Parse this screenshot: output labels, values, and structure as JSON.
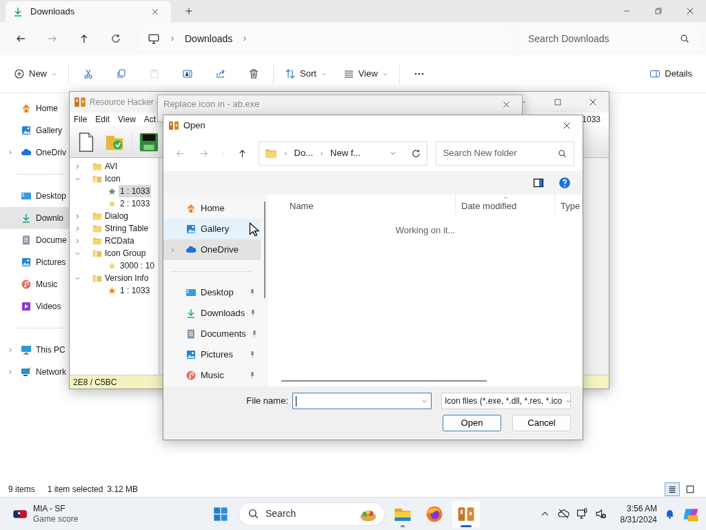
{
  "explorer": {
    "tab": {
      "title": "Downloads"
    },
    "nav_buttons": [
      {
        "kind": "back",
        "disabled": false
      },
      {
        "kind": "forward",
        "disabled": true
      },
      {
        "kind": "up",
        "disabled": false
      },
      {
        "kind": "refresh",
        "disabled": false
      }
    ],
    "address": {
      "path": [
        "Downloads"
      ]
    },
    "search": {
      "placeholder": "Search Downloads"
    },
    "commands": [
      {
        "kind": "new",
        "label": "New",
        "disabled": false
      },
      {
        "kind": "cut",
        "disabled": false
      },
      {
        "kind": "copy",
        "disabled": false
      },
      {
        "kind": "paste",
        "disabled": true
      },
      {
        "kind": "rename",
        "disabled": false
      },
      {
        "kind": "share",
        "disabled": false
      },
      {
        "kind": "delete",
        "disabled": false
      },
      {
        "kind": "sort",
        "label": "Sort",
        "disabled": false
      },
      {
        "kind": "view",
        "label": "View",
        "disabled": false
      },
      {
        "kind": "more",
        "disabled": false
      }
    ],
    "details_button": "Details",
    "sidebar": {
      "groups": [
        [
          {
            "kind": "home",
            "label": "Home",
            "selected": false,
            "expandable": false
          },
          {
            "kind": "gallery",
            "label": "Gallery",
            "selected": false,
            "expandable": false
          },
          {
            "kind": "cloud",
            "label": "OneDriv",
            "selected": false,
            "expandable": true
          }
        ],
        [
          {
            "kind": "desktop",
            "label": "Desktop",
            "selected": false,
            "expandable": false
          },
          {
            "kind": "download",
            "label": "Downlo",
            "selected": true,
            "expandable": false
          },
          {
            "kind": "document",
            "label": "Docume",
            "selected": false,
            "expandable": false
          },
          {
            "kind": "pictures",
            "label": "Pictures",
            "selected": false,
            "expandable": false
          },
          {
            "kind": "music",
            "label": "Music",
            "selected": false,
            "expandable": false
          },
          {
            "kind": "videos",
            "label": "Videos",
            "selected": false,
            "expandable": false
          }
        ],
        [
          {
            "kind": "pc",
            "label": "This PC",
            "selected": false,
            "expandable": true
          },
          {
            "kind": "network",
            "label": "Network",
            "selected": false,
            "expandable": true
          }
        ]
      ]
    },
    "status": {
      "count": "9 items",
      "selection": "1 item selected",
      "size": "3.12 MB"
    },
    "view_modes": [
      {
        "kind": "details",
        "selected": true
      },
      {
        "kind": "tiles",
        "selected": false
      }
    ]
  },
  "resource_hacker": {
    "title": "Resource Hacker -",
    "menu": [
      "File",
      "Edit",
      "View",
      "Act"
    ],
    "toolbar": [
      {
        "kind": "new"
      },
      {
        "kind": "open"
      },
      {
        "kind": "save"
      }
    ],
    "side_value": "1033",
    "tree": [
      {
        "label": "AVI",
        "expanded": false
      },
      {
        "label": "Icon",
        "expanded": true,
        "children": [
          {
            "label": "1 : 1033",
            "selected": true,
            "color": "#6f8f5a"
          },
          {
            "label": "2 : 1033",
            "selected": false,
            "color": "#f2d36b"
          }
        ]
      },
      {
        "label": "Dialog",
        "expanded": false
      },
      {
        "label": "String Table",
        "expanded": false
      },
      {
        "label": "RCData",
        "expanded": false
      },
      {
        "label": "Icon Group",
        "expanded": true,
        "children": [
          {
            "label": "3000 : 10",
            "selected": false,
            "color": "#f2d36b"
          }
        ]
      },
      {
        "label": "Version Info",
        "expanded": true,
        "children": [
          {
            "label": "1 : 1033",
            "selected": false,
            "color": "#f08a24"
          }
        ]
      }
    ],
    "status": "2E8 / C5BC"
  },
  "replace_dialog": {
    "title": "Replace icon in - ab.exe"
  },
  "open_dialog": {
    "title": "Open",
    "nav_buttons": [
      {
        "kind": "back",
        "disabled": true
      },
      {
        "kind": "forward",
        "disabled": true
      },
      {
        "kind": "recent",
        "disabled": true
      },
      {
        "kind": "up",
        "disabled": false
      }
    ],
    "breadcrumb": [
      "Do...",
      "New f..."
    ],
    "search": {
      "placeholder": "Search New folder"
    },
    "nav_pane": {
      "groups": [
        [
          {
            "kind": "home",
            "label": "Home",
            "selected": false,
            "hovered": false,
            "expandable": false,
            "pinned": false
          },
          {
            "kind": "gallery",
            "label": "Gallery",
            "selected": false,
            "hovered": true,
            "expandable": false,
            "pinned": false
          },
          {
            "kind": "cloud",
            "label": "OneDrive",
            "selected": true,
            "hovered": false,
            "expandable": true,
            "pinned": false
          }
        ],
        [
          {
            "kind": "desktop",
            "label": "Desktop",
            "selected": false,
            "hovered": false,
            "expandable": false,
            "pinned": true
          },
          {
            "kind": "download",
            "label": "Downloads",
            "selected": false,
            "hovered": false,
            "expandable": false,
            "pinned": true
          },
          {
            "kind": "document",
            "label": "Documents",
            "selected": false,
            "hovered": false,
            "expandable": false,
            "pinned": true
          },
          {
            "kind": "pictures",
            "label": "Pictures",
            "selected": false,
            "hovered": false,
            "expandable": false,
            "pinned": true
          },
          {
            "kind": "music",
            "label": "Music",
            "selected": false,
            "hovered": false,
            "expandable": false,
            "pinned": true
          }
        ]
      ]
    },
    "columns": [
      {
        "label": "Name",
        "sorted": false
      },
      {
        "label": "Date modified",
        "sorted": true
      },
      {
        "label": "Type",
        "sorted": false
      }
    ],
    "message": "Working on it...",
    "file_name_label": "File name:",
    "file_type": "Icon files (*.exe, *.dll, *.res, *.ico",
    "buttons": [
      {
        "label": "Open",
        "default": true
      },
      {
        "label": "Cancel",
        "default": false
      }
    ]
  },
  "taskbar": {
    "widget": {
      "title": "MIA - SF",
      "subtitle": "Game score"
    },
    "search_label": "Search",
    "apps": [
      {
        "kind": "explorer",
        "running": true,
        "active": false
      },
      {
        "kind": "firefox",
        "running": false,
        "active": false
      },
      {
        "kind": "resource_hacker",
        "running": true,
        "active": true
      }
    ],
    "clock": {
      "time": "3:56 AM",
      "date": "8/31/2024"
    }
  }
}
